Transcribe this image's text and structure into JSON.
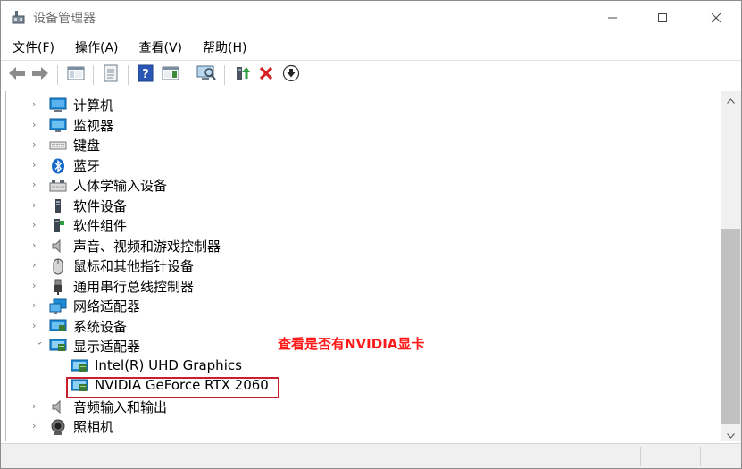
{
  "window": {
    "title": "设备管理器",
    "controls": {
      "minimize": "minimize-icon",
      "maximize": "maximize-icon",
      "close": "close-icon"
    }
  },
  "menu": [
    {
      "label": "文件(F)"
    },
    {
      "label": "操作(A)"
    },
    {
      "label": "查看(V)"
    },
    {
      "label": "帮助(H)"
    }
  ],
  "toolbar": [
    {
      "name": "back-icon"
    },
    {
      "name": "forward-icon"
    },
    {
      "name": "show-hide-console-tree-icon"
    },
    {
      "name": "properties-icon"
    },
    {
      "name": "help-icon"
    },
    {
      "name": "action-pane-icon"
    },
    {
      "name": "scan-hardware-icon"
    },
    {
      "name": "update-driver-icon"
    },
    {
      "name": "uninstall-device-icon"
    },
    {
      "name": "disable-device-icon"
    }
  ],
  "tree": {
    "items": [
      {
        "label": "计算机",
        "icon": "computer-icon",
        "state": "collapsed"
      },
      {
        "label": "监视器",
        "icon": "monitor-icon",
        "state": "collapsed"
      },
      {
        "label": "键盘",
        "icon": "keyboard-icon",
        "state": "collapsed"
      },
      {
        "label": "蓝牙",
        "icon": "bluetooth-icon",
        "state": "collapsed"
      },
      {
        "label": "人体学输入设备",
        "icon": "hid-icon",
        "state": "collapsed"
      },
      {
        "label": "软件设备",
        "icon": "software-device-icon",
        "state": "collapsed"
      },
      {
        "label": "软件组件",
        "icon": "software-component-icon",
        "state": "collapsed"
      },
      {
        "label": "声音、视频和游戏控制器",
        "icon": "speaker-icon",
        "state": "collapsed"
      },
      {
        "label": "鼠标和其他指针设备",
        "icon": "mouse-icon",
        "state": "collapsed"
      },
      {
        "label": "通用串行总线控制器",
        "icon": "usb-icon",
        "state": "collapsed"
      },
      {
        "label": "网络适配器",
        "icon": "network-adapter-icon",
        "state": "collapsed"
      },
      {
        "label": "系统设备",
        "icon": "system-device-icon",
        "state": "collapsed"
      },
      {
        "label": "显示适配器",
        "icon": "display-adapter-icon",
        "state": "expanded",
        "children": [
          {
            "label": "Intel(R) UHD Graphics",
            "icon": "display-adapter-icon"
          },
          {
            "label": "NVIDIA GeForce RTX 2060",
            "icon": "display-adapter-icon",
            "highlighted": true
          }
        ]
      },
      {
        "label": "音频输入和输出",
        "icon": "speaker-icon",
        "state": "collapsed"
      },
      {
        "label": "照相机",
        "icon": "camera-icon",
        "state": "collapsed"
      }
    ]
  },
  "annotation": {
    "text": "查看是否有NVIDIA显卡",
    "color": "#ff1a1a"
  },
  "colors": {
    "highlight_border": "#c8202f",
    "scroll_thumb": "#c1c1c1"
  }
}
